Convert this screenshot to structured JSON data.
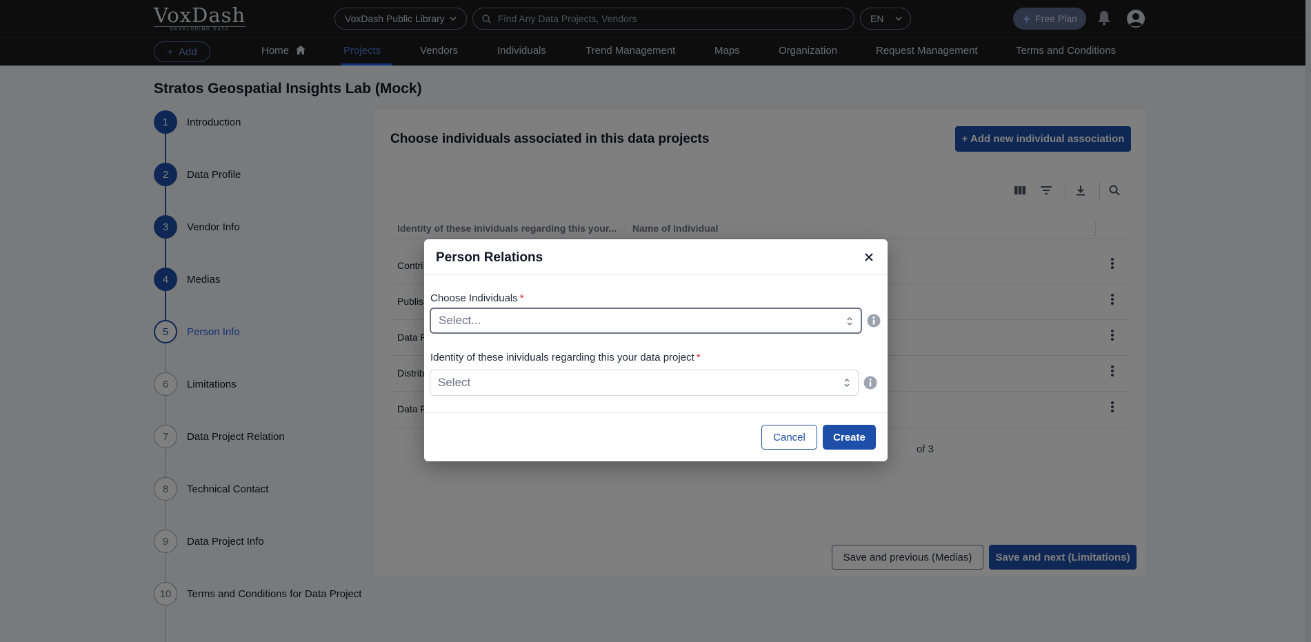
{
  "header": {
    "logo_text": "VoxDash",
    "logo_tagline": "DEVELOPING DATA",
    "library_select": "VoxDash Public Library",
    "search_placeholder": "Find Any Data Projects, Vendors",
    "language": "EN",
    "free_plan": "Free Plan"
  },
  "nav": {
    "add": "Add",
    "items": [
      "Home",
      "Projects",
      "Vendors",
      "Individuals",
      "Trend Management",
      "Maps",
      "Organization",
      "Request Management",
      "Terms and Conditions"
    ],
    "active": "Projects"
  },
  "page": {
    "title": "Stratos Geospatial Insights Lab (Mock)"
  },
  "steps": [
    {
      "num": "1",
      "label": "Introduction",
      "state": "done"
    },
    {
      "num": "2",
      "label": "Data Profile",
      "state": "done"
    },
    {
      "num": "3",
      "label": "Vendor Info",
      "state": "done"
    },
    {
      "num": "4",
      "label": "Medias",
      "state": "done"
    },
    {
      "num": "5",
      "label": "Person Info",
      "state": "current"
    },
    {
      "num": "6",
      "label": "Limitations",
      "state": "todo"
    },
    {
      "num": "7",
      "label": "Data Project Relation",
      "state": "todo"
    },
    {
      "num": "8",
      "label": "Technical Contact",
      "state": "todo"
    },
    {
      "num": "9",
      "label": "Data Project Info",
      "state": "todo"
    },
    {
      "num": "10",
      "label": "Terms and Conditions for Data Project",
      "state": "todo"
    }
  ],
  "content": {
    "title": "Choose individuals associated in this data projects",
    "add_button": "+ Add new individual association",
    "columns": [
      "Identity of these inividuals regarding this your...",
      "Name of Individual"
    ],
    "rows": [
      "Contri",
      "Publis",
      "Data F",
      "Distrib",
      "Data F"
    ],
    "pager_text": "of 3",
    "save_prev": "Save and previous (Medias)",
    "save_next": "Save and next (Limitations)"
  },
  "modal": {
    "title": "Person Relations",
    "field1_label": "Choose Individuals",
    "field1_placeholder": "Select...",
    "field2_label": "Identity of these inividuals regarding this your data project",
    "field2_placeholder": "Select",
    "required_mark": "*",
    "cancel": "Cancel",
    "create": "Create"
  },
  "colors": {
    "primary": "#1e4fa8",
    "required": "#dc2626",
    "header_bg": "#1a1a1a"
  }
}
